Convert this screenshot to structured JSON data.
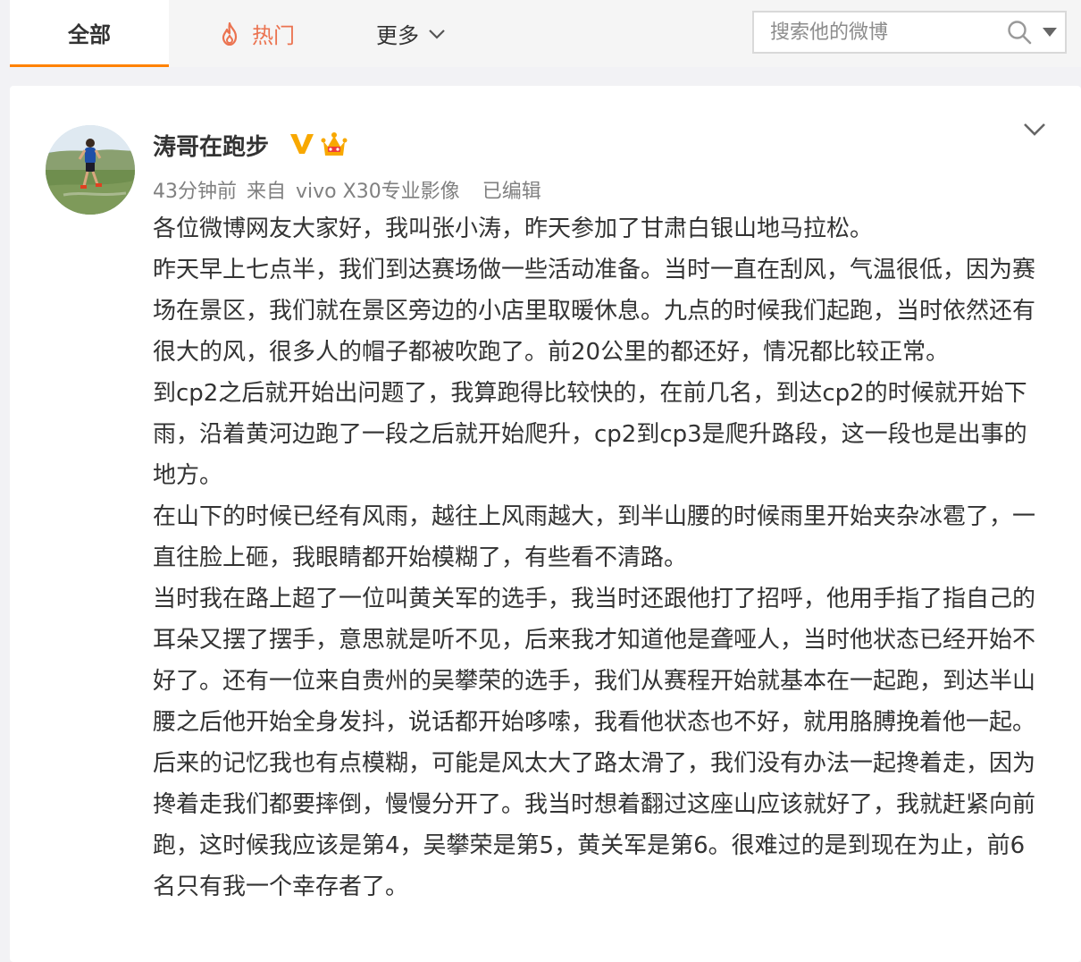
{
  "tabs": {
    "all": "全部",
    "hot": "热门",
    "more": "更多"
  },
  "search": {
    "placeholder": "搜索他的微博"
  },
  "post": {
    "author": "涛哥在跑步",
    "time": "43分钟前",
    "source_prefix": "来自",
    "source": "vivo X30专业影像",
    "edited": "已编辑",
    "paragraphs": [
      "各位微博网友大家好，我叫张小涛，昨天参加了甘肃白银山地马拉松。",
      "昨天早上七点半，我们到达赛场做一些活动准备。当时一直在刮风，气温很低，因为赛场在景区，我们就在景区旁边的小店里取暖休息。九点的时候我们起跑，当时依然还有很大的风，很多人的帽子都被吹跑了。前20公里的都还好，情况都比较正常。",
      "到cp2之后就开始出问题了，我算跑得比较快的，在前几名，到达cp2的时候就开始下雨，沿着黄河边跑了一段之后就开始爬升，cp2到cp3是爬升路段，这一段也是出事的地方。",
      "在山下的时候已经有风雨，越往上风雨越大，到半山腰的时候雨里开始夹杂冰雹了，一直往脸上砸，我眼睛都开始模糊了，有些看不清路。",
      "当时我在路上超了一位叫黄关军的选手，我当时还跟他打了招呼，他用手指了指自己的耳朵又摆了摆手，意思就是听不见，后来我才知道他是聋哑人，当时他状态已经开始不好了。还有一位来自贵州的吴攀荣的选手，我们从赛程开始就基本在一起跑，到达半山腰之后他开始全身发抖，说话都开始哆嗦，我看他状态也不好，就用胳膊挽着他一起。后来的记忆我也有点模糊，可能是风太大了路太滑了，我们没有办法一起搀着走，因为搀着走我们都要摔倒，慢慢分开了。我当时想着翻过这座山应该就好了，我就赶紧向前跑，这时候我应该是第4，吴攀荣是第5，黄关军是第6。很难过的是到现在为止，前6名只有我一个幸存者了。"
    ]
  },
  "colors": {
    "accent": "#ff8200",
    "hot": "#eb7350",
    "verified": "#f8a800"
  }
}
